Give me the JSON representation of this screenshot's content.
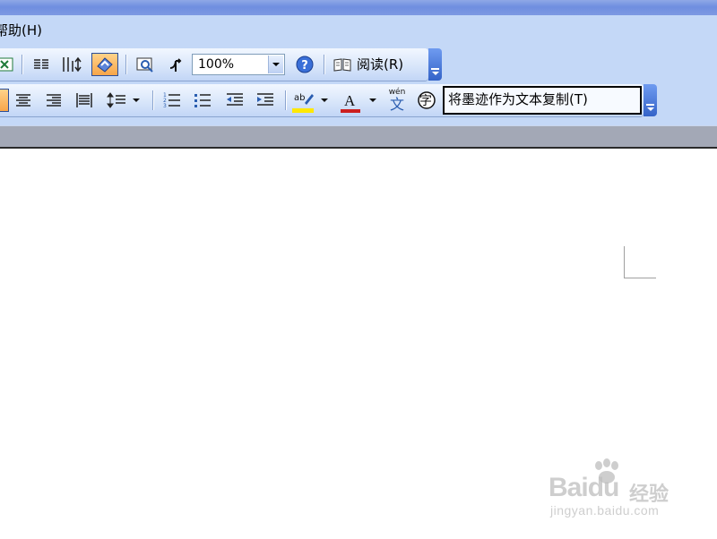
{
  "menubar": {
    "help_label": "帮助(H)"
  },
  "standard_toolbar": {
    "zoom_value": "100%",
    "read_label": "阅读(R)"
  },
  "formatting_toolbar": {
    "ink_copy_label": "将墨迹作为文本复制(T)",
    "phonetic_label": "wén",
    "phonetic_char": "文",
    "enclose_char": "字"
  },
  "watermark": {
    "brand": "Bai",
    "brand_tail": "du",
    "experience": "经验",
    "url": "jingyan.baidu.com"
  },
  "colors": {
    "accent_blue": "#3463c8",
    "toolbar_bg": "#c4d8f7",
    "highlight_yellow": "#ffe800",
    "font_color_red": "#cc1f1f"
  }
}
